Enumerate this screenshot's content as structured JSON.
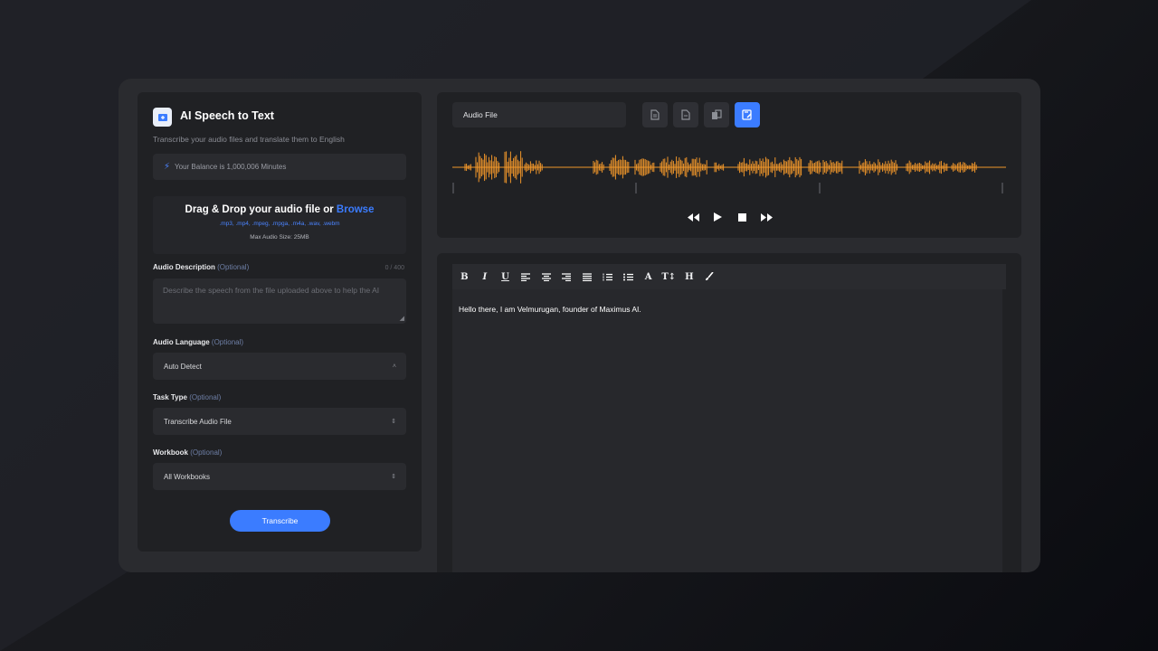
{
  "app": {
    "title": "AI Speech to Text",
    "subtitle": "Transcribe your audio files and translate them to English",
    "balance": "Your Balance is 1,000,006 Minutes",
    "accent": "#3b7cff"
  },
  "upload": {
    "prompt": "Drag & Drop your audio file or ",
    "browse": "Browse",
    "formats": ".mp3, .mp4, .mpeg, .mpga, .m4a, .wav, .webm",
    "max_size": "Max Audio Size: 25MB"
  },
  "form": {
    "description": {
      "label": "Audio Description",
      "optional": "(Optional)",
      "counter": "0 / 400",
      "placeholder": "Describe the speech from the file uploaded above to help the AI"
    },
    "language": {
      "label": "Audio Language",
      "optional": "(Optional)",
      "value": "Auto Detect"
    },
    "task": {
      "label": "Task Type",
      "optional": "(Optional)",
      "value": "Transcribe Audio File"
    },
    "workbook": {
      "label": "Workbook",
      "optional": "(Optional)",
      "value": "All Workbooks"
    },
    "submit": "Transcribe"
  },
  "audio": {
    "file_label": "Audio File",
    "tools": [
      "file-text-icon",
      "file-icon",
      "copy-icon",
      "save-edit-icon"
    ],
    "waveform_color": "#f0962a",
    "controls": [
      "rewind-icon",
      "play-icon",
      "stop-icon",
      "fast-forward-icon"
    ]
  },
  "editor": {
    "toolbar": [
      "bold-icon",
      "italic-icon",
      "underline-icon",
      "align-left-icon",
      "align-center-icon",
      "align-right-icon",
      "align-justify-icon",
      "ordered-list-icon",
      "unordered-list-icon",
      "font-color-icon",
      "font-size-icon",
      "heading-icon",
      "brush-icon"
    ],
    "content": "Hello there, I am Velmurugan, founder of Maximus AI."
  }
}
